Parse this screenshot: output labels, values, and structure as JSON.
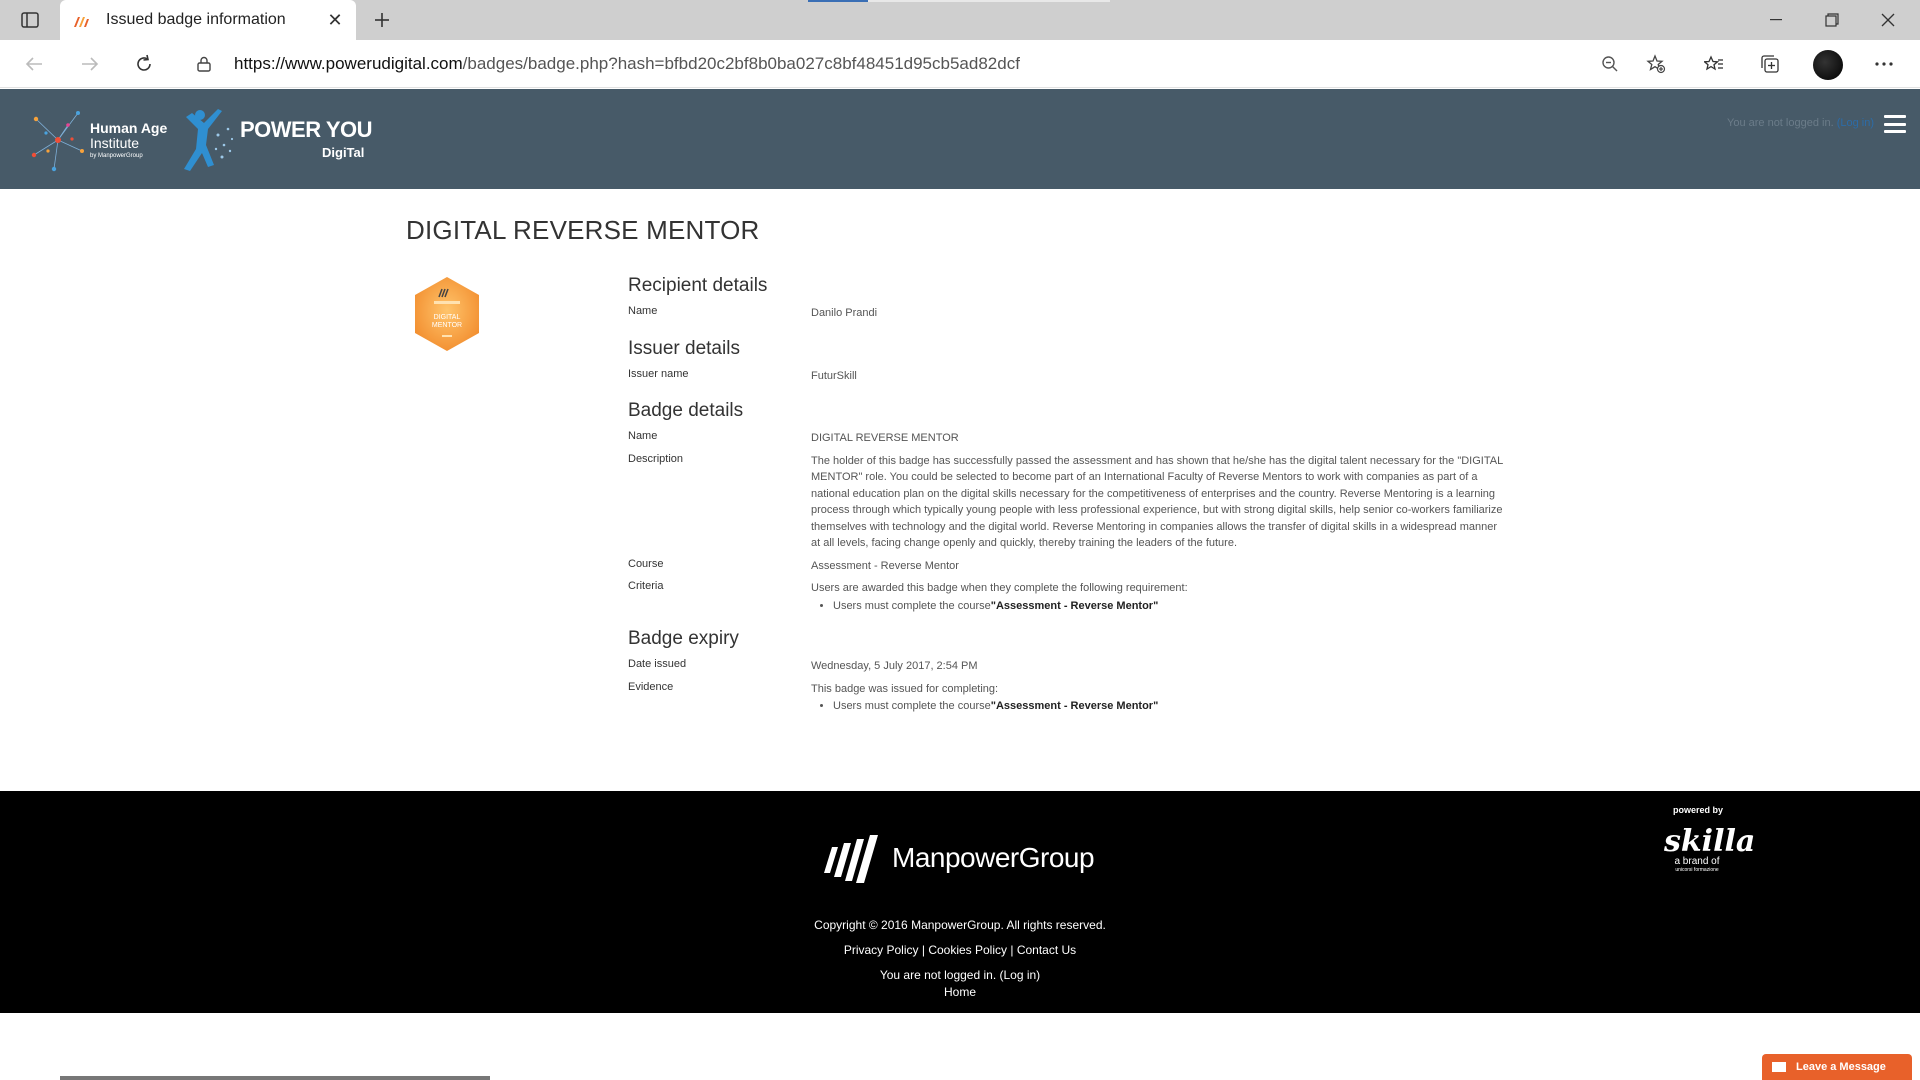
{
  "browser": {
    "tab_title": "Issued badge information",
    "url_host": "https://www.powerudigital.com",
    "url_path": "/badges/badge.php?hash=bfbd20c2bf8b0ba027c8bf48451d95cb5ad82dcf"
  },
  "header": {
    "hai_logo_line1": "Human Age",
    "hai_logo_line2": "Institute",
    "hai_logo_sub": "by ManpowerGroup",
    "py_logo_main": "POWER YOU",
    "py_logo_sub": "DigiTal",
    "login_text": "You are not logged in.",
    "login_link": "(Log in)"
  },
  "page": {
    "title": "DIGITAL REVERSE MENTOR",
    "badge_image_text": "DIGITAL MENTOR"
  },
  "recipient": {
    "heading": "Recipient details",
    "name_label": "Name",
    "name_value": "Danilo Prandi"
  },
  "issuer": {
    "heading": "Issuer details",
    "name_label": "Issuer name",
    "name_value": "FuturSkill"
  },
  "badge": {
    "heading": "Badge details",
    "name_label": "Name",
    "name_value": "DIGITAL REVERSE MENTOR",
    "description_label": "Description",
    "description_value": "The holder of this badge has successfully passed the assessment and has shown that he/she has the digital talent necessary for the \"DIGITAL MENTOR\" role. You could be selected to become part of an International Faculty of Reverse Mentors to work with companies as part of a national education plan on the digital skills necessary for the competitiveness of enterprises and the country. Reverse Mentoring is a learning process through which typically young people with less professional experience, but with strong digital skills, help senior co-workers familiarize themselves with technology and the digital world. Reverse Mentoring in companies allows the transfer of digital skills in a widespread manner at all levels, facing change openly and quickly, thereby training the leaders of the future.",
    "course_label": "Course",
    "course_value": "Assessment - Reverse Mentor",
    "criteria_label": "Criteria",
    "criteria_intro": "Users are awarded this badge when they complete the following requirement:",
    "criteria_item_prefix": "Users must complete the course",
    "criteria_item_course": "\"Assessment - Reverse Mentor\""
  },
  "expiry": {
    "heading": "Badge expiry",
    "date_label": "Date issued",
    "date_value": "Wednesday, 5 July 2017, 2:54 PM",
    "evidence_label": "Evidence",
    "evidence_intro": "This badge was issued for completing:",
    "evidence_item_prefix": "Users must complete the course",
    "evidence_item_course": "\"Assessment - Reverse Mentor\""
  },
  "footer": {
    "brand": "ManpowerGroup",
    "copyright": "Copyright © 2016 ManpowerGroup. All rights reserved.",
    "privacy": "Privacy Policy",
    "cookies": "Cookies Policy",
    "contact": "Contact Us",
    "sep": " | ",
    "login_text": "You are not logged in. ",
    "login_link": "(Log in)",
    "home": "Home",
    "powered_by": "powered by",
    "skilla": "skilla",
    "skilla_sub": "a brand of",
    "skilla_sub2": "unicorsi formazione"
  },
  "chat": {
    "label": "Leave a Message"
  },
  "colors": {
    "header_bg": "#475a68",
    "footer_bg": "#000000",
    "badge_orange": "#f7a23b",
    "chat_orange": "#e8612a"
  }
}
